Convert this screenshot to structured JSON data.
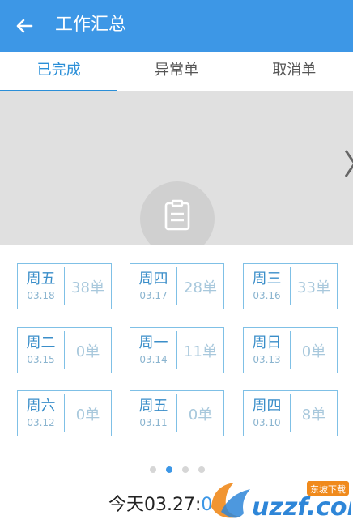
{
  "appbar": {
    "title": "工作汇总",
    "back_icon": "arrow-left-icon"
  },
  "tabs": [
    {
      "label": "已完成",
      "active": true
    },
    {
      "label": "异常单",
      "active": false
    },
    {
      "label": "取消单",
      "active": false
    }
  ],
  "banner": {
    "icon": "clipboard-icon",
    "next_icon": "chevron-right-icon"
  },
  "days": [
    {
      "day": "周五",
      "date": "03.18",
      "count": "38单"
    },
    {
      "day": "周四",
      "date": "03.17",
      "count": "28单"
    },
    {
      "day": "周三",
      "date": "03.16",
      "count": "33单"
    },
    {
      "day": "周二",
      "date": "03.15",
      "count": "0单"
    },
    {
      "day": "周一",
      "date": "03.14",
      "count": "11单"
    },
    {
      "day": "周日",
      "date": "03.13",
      "count": "0单"
    },
    {
      "day": "周六",
      "date": "03.12",
      "count": "0单"
    },
    {
      "day": "周五",
      "date": "03.11",
      "count": "0单"
    },
    {
      "day": "周四",
      "date": "03.10",
      "count": "8单"
    }
  ],
  "pager": {
    "count": 4,
    "active_index": 1
  },
  "today": {
    "label": "今天03.27:",
    "count": "0"
  },
  "watermark": {
    "text": "uzzf.com",
    "tag": "东坡下载"
  },
  "colors": {
    "primary": "#3d97e6",
    "tab_active": "#2b8fd8",
    "card_border": "#7fc0e6",
    "banner_bg": "#e0e0e0"
  }
}
